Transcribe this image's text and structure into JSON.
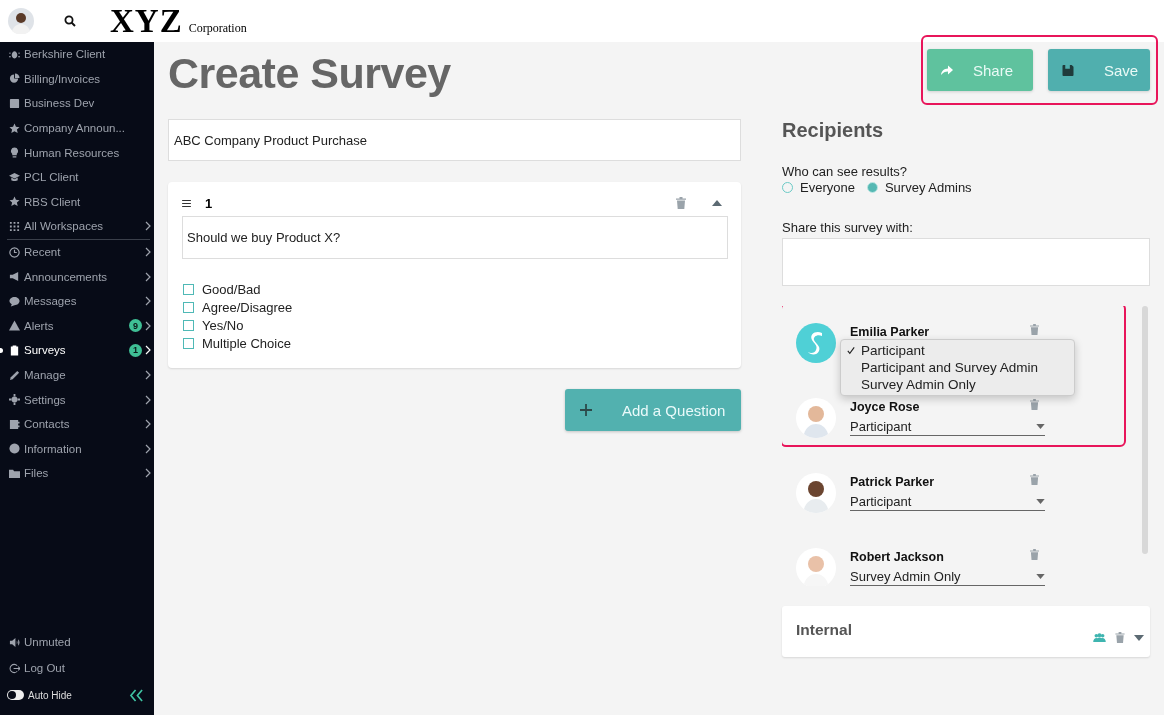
{
  "topbar": {
    "logo": "XYZ",
    "logo_sub": "Corporation"
  },
  "sidebar": {
    "items": [
      {
        "label": "Berkshire Client",
        "chevron": false,
        "selected": false
      },
      {
        "label": "Billing/Invoices",
        "chevron": false,
        "selected": false
      },
      {
        "label": "Business Dev",
        "chevron": false,
        "selected": false
      },
      {
        "label": "Company Announ...",
        "chevron": false,
        "selected": false
      },
      {
        "label": "Human Resources",
        "chevron": false,
        "selected": false
      },
      {
        "label": "PCL Client",
        "chevron": false,
        "selected": false
      },
      {
        "label": "RBS Client",
        "chevron": false,
        "selected": false
      },
      {
        "label": "All Workspaces",
        "chevron": true,
        "selected": false,
        "divider_after": true
      },
      {
        "label": "Recent",
        "chevron": true,
        "selected": false
      },
      {
        "label": "Announcements",
        "chevron": true,
        "selected": false
      },
      {
        "label": "Messages",
        "chevron": true,
        "selected": false
      },
      {
        "label": "Alerts",
        "chevron": true,
        "selected": false,
        "badge": "9"
      },
      {
        "label": "Surveys",
        "chevron": true,
        "selected": true,
        "badge": "1"
      },
      {
        "label": "Manage",
        "chevron": true,
        "selected": false
      },
      {
        "label": "Settings",
        "chevron": true,
        "selected": false
      },
      {
        "label": "Contacts",
        "chevron": true,
        "selected": false
      },
      {
        "label": "Information",
        "chevron": true,
        "selected": false
      },
      {
        "label": "Files",
        "chevron": true,
        "selected": false
      }
    ],
    "footer": [
      {
        "label": "Unmuted"
      },
      {
        "label": "Log Out"
      }
    ],
    "auto_hide": {
      "label": "Auto Hide",
      "on": false
    }
  },
  "page": {
    "title": "Create Survey",
    "buttons": [
      {
        "label": "Share",
        "kind": "share"
      },
      {
        "label": "Save",
        "kind": "save"
      }
    ]
  },
  "survey": {
    "name": "ABC Company Product Purchase",
    "questions": [
      {
        "number": "1",
        "text": "Should we buy Product X?",
        "expanded": true,
        "options": [
          {
            "label": "Good/Bad",
            "checked": false
          },
          {
            "label": "Agree/Disagree",
            "checked": false
          },
          {
            "label": "Yes/No",
            "checked": false
          },
          {
            "label": "Multiple Choice",
            "checked": false
          }
        ]
      }
    ],
    "add_button": "Add a Question"
  },
  "recipients": {
    "title": "Recipients",
    "visibility_label": "Who can see results?",
    "visibility": [
      {
        "label": "Everyone",
        "selected": false
      },
      {
        "label": "Survey Admins",
        "selected": true
      }
    ],
    "share_label": "Share this survey with:",
    "people": [
      {
        "name": "Emilia Parker",
        "kind": "logo"
      },
      {
        "name": "Joyce Rose",
        "role": "Participant",
        "kind": "photo"
      },
      {
        "name": "Patrick Parker",
        "role": "Participant",
        "kind": "photo"
      },
      {
        "name": "Robert Jackson",
        "role": "Survey Admin Only",
        "kind": "photo"
      }
    ],
    "role_menu": {
      "options": [
        {
          "label": "Participant",
          "selected": true
        },
        {
          "label": "Participant and Survey Admin",
          "selected": false
        },
        {
          "label": "Survey Admin Only",
          "selected": false
        }
      ]
    },
    "groups": [
      {
        "name": "Internal",
        "expanded": false
      }
    ]
  }
}
